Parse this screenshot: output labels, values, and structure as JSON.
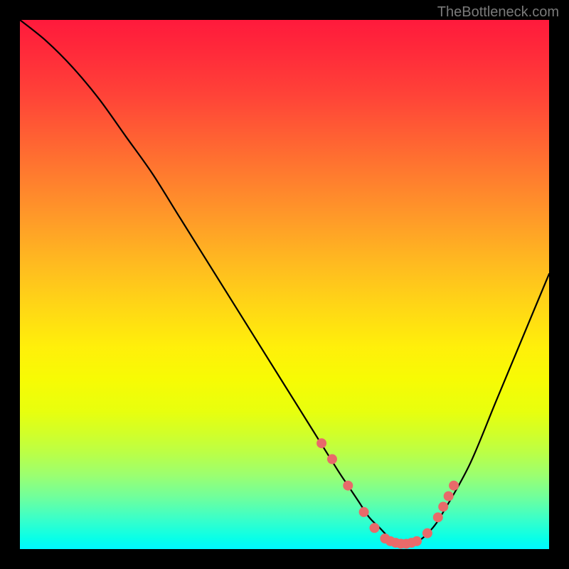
{
  "watermark": "TheBottleneck.com",
  "chart_data": {
    "type": "line",
    "title": "",
    "xlabel": "",
    "ylabel": "",
    "xlim": [
      0,
      100
    ],
    "ylim": [
      0,
      100
    ],
    "series": [
      {
        "name": "curve",
        "x": [
          0,
          5,
          10,
          15,
          20,
          25,
          30,
          35,
          40,
          45,
          50,
          55,
          60,
          62,
          64,
          66,
          68,
          70,
          72,
          74,
          76,
          78,
          80,
          85,
          90,
          95,
          100
        ],
        "y": [
          100,
          96,
          91,
          85,
          78,
          71,
          63,
          55,
          47,
          39,
          31,
          23,
          15,
          12,
          9,
          6,
          4,
          2,
          1,
          1,
          2,
          4,
          7,
          16,
          28,
          40,
          52
        ]
      }
    ],
    "markers": {
      "name": "dots",
      "color": "#e86a6a",
      "x": [
        57,
        59,
        62,
        65,
        67,
        69,
        70,
        71,
        72,
        73,
        74,
        75,
        77,
        79,
        80,
        81,
        82
      ],
      "y": [
        20,
        17,
        12,
        7,
        4,
        2,
        1.5,
        1.2,
        1,
        1,
        1.2,
        1.5,
        3,
        6,
        8,
        10,
        12
      ]
    },
    "gradient_stops": [
      {
        "pct": 0,
        "color": "#ff1a3c"
      },
      {
        "pct": 50,
        "color": "#ffd616"
      },
      {
        "pct": 80,
        "color": "#baff48"
      },
      {
        "pct": 100,
        "color": "#00f8ff"
      }
    ]
  }
}
